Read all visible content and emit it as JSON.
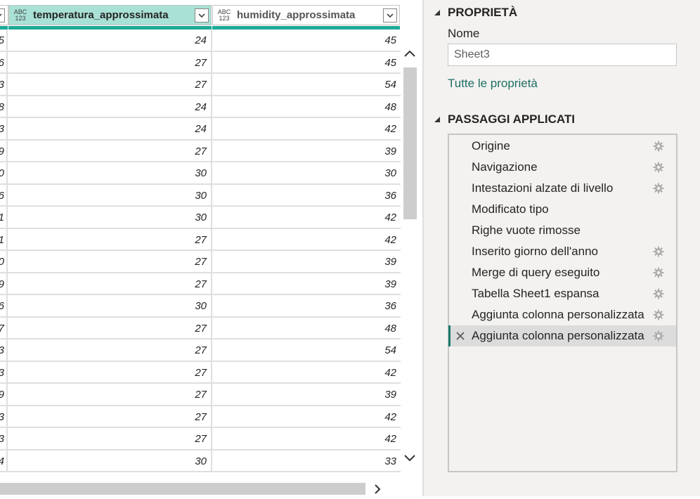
{
  "grid": {
    "columns": [
      {
        "type_icon": [
          "ABC",
          "123"
        ],
        "title": "temperatura_approssimata"
      },
      {
        "type_icon": [
          "ABC",
          "123"
        ],
        "title": "humidity_approssimata"
      }
    ],
    "rows": [
      {
        "stub": "5",
        "temp": "24",
        "hum": "45"
      },
      {
        "stub": "6",
        "temp": "27",
        "hum": "45"
      },
      {
        "stub": "3",
        "temp": "27",
        "hum": "54"
      },
      {
        "stub": "8",
        "temp": "24",
        "hum": "48"
      },
      {
        "stub": "3",
        "temp": "24",
        "hum": "42"
      },
      {
        "stub": "9",
        "temp": "27",
        "hum": "39"
      },
      {
        "stub": "0",
        "temp": "30",
        "hum": "30"
      },
      {
        "stub": "6",
        "temp": "30",
        "hum": "36"
      },
      {
        "stub": "1",
        "temp": "30",
        "hum": "42"
      },
      {
        "stub": "1",
        "temp": "27",
        "hum": "42"
      },
      {
        "stub": "0",
        "temp": "27",
        "hum": "39"
      },
      {
        "stub": "9",
        "temp": "27",
        "hum": "39"
      },
      {
        "stub": "6",
        "temp": "30",
        "hum": "36"
      },
      {
        "stub": "7",
        "temp": "27",
        "hum": "48"
      },
      {
        "stub": "3",
        "temp": "27",
        "hum": "54"
      },
      {
        "stub": "3",
        "temp": "27",
        "hum": "42"
      },
      {
        "stub": "9",
        "temp": "27",
        "hum": "39"
      },
      {
        "stub": "3",
        "temp": "27",
        "hum": "42"
      },
      {
        "stub": "3",
        "temp": "27",
        "hum": "42"
      },
      {
        "stub": "4",
        "temp": "30",
        "hum": "33"
      }
    ]
  },
  "properties": {
    "heading": "PROPRIETÀ",
    "name_label": "Nome",
    "name_value": "Sheet3",
    "all_properties_link": "Tutte le proprietà"
  },
  "applied_steps": {
    "heading": "PASSAGGI APPLICATI",
    "steps": [
      {
        "label": "Origine",
        "gear": true
      },
      {
        "label": "Navigazione",
        "gear": true
      },
      {
        "label": "Intestazioni alzate di livello",
        "gear": true
      },
      {
        "label": "Modificato tipo",
        "gear": false
      },
      {
        "label": "Righe vuote rimosse",
        "gear": false
      },
      {
        "label": "Inserito giorno dell'anno",
        "gear": true
      },
      {
        "label": "Merge di query eseguito",
        "gear": true
      },
      {
        "label": "Tabella Sheet1 espansa",
        "gear": true
      },
      {
        "label": "Aggiunta colonna personalizzata",
        "gear": true
      },
      {
        "label": "Aggiunta colonna personalizzata",
        "gear": true,
        "selected": true
      }
    ]
  },
  "colors": {
    "header_selected": "#a9e1d6",
    "quality_bar": "#1faa98",
    "selected_step": "#dcdcdc",
    "link": "#1f6f63"
  },
  "icons": {
    "column_dropdown": "chevron-down-icon",
    "step_settings": "gear-icon",
    "step_delete": "close-icon",
    "scroll_up": "chevron-up-icon",
    "scroll_down": "chevron-down-icon",
    "scroll_right": "chevron-right-icon",
    "section_toggle": "triangle-collapse-icon"
  }
}
